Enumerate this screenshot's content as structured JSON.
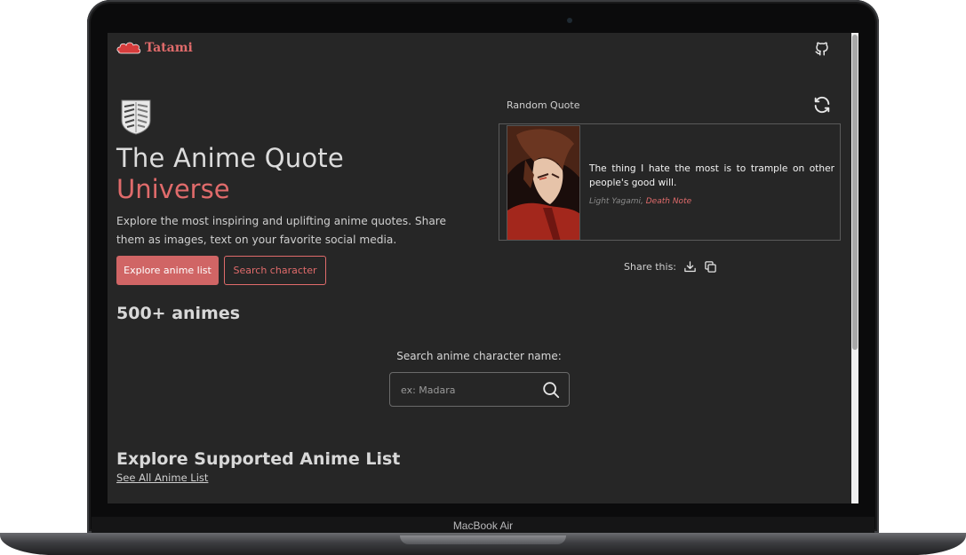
{
  "device": {
    "label": "MacBook Air"
  },
  "header": {
    "brand": "Tatami"
  },
  "hero": {
    "title_line1": "The Anime Quote",
    "title_line2": "Universe",
    "description": "Explore the most inspiring and uplifting anime quotes. Share them as images, text on your favorite social media.",
    "primary_button": "Explore anime list",
    "secondary_button": "Search character",
    "count_label": "500+ animes"
  },
  "random_quote": {
    "label": "Random Quote",
    "text": "The thing I hate the most is to trample on other people's good will.",
    "character": "Light Yagami,",
    "anime": "Death Note",
    "share_label": "Share this:"
  },
  "search": {
    "label": "Search anime character name:",
    "placeholder": "ex: Madara"
  },
  "explore": {
    "title": "Explore Supported Anime List",
    "link": "See All Anime List"
  },
  "colors": {
    "accent": "#e06b6b",
    "background": "#262626",
    "button": "#d06565"
  }
}
